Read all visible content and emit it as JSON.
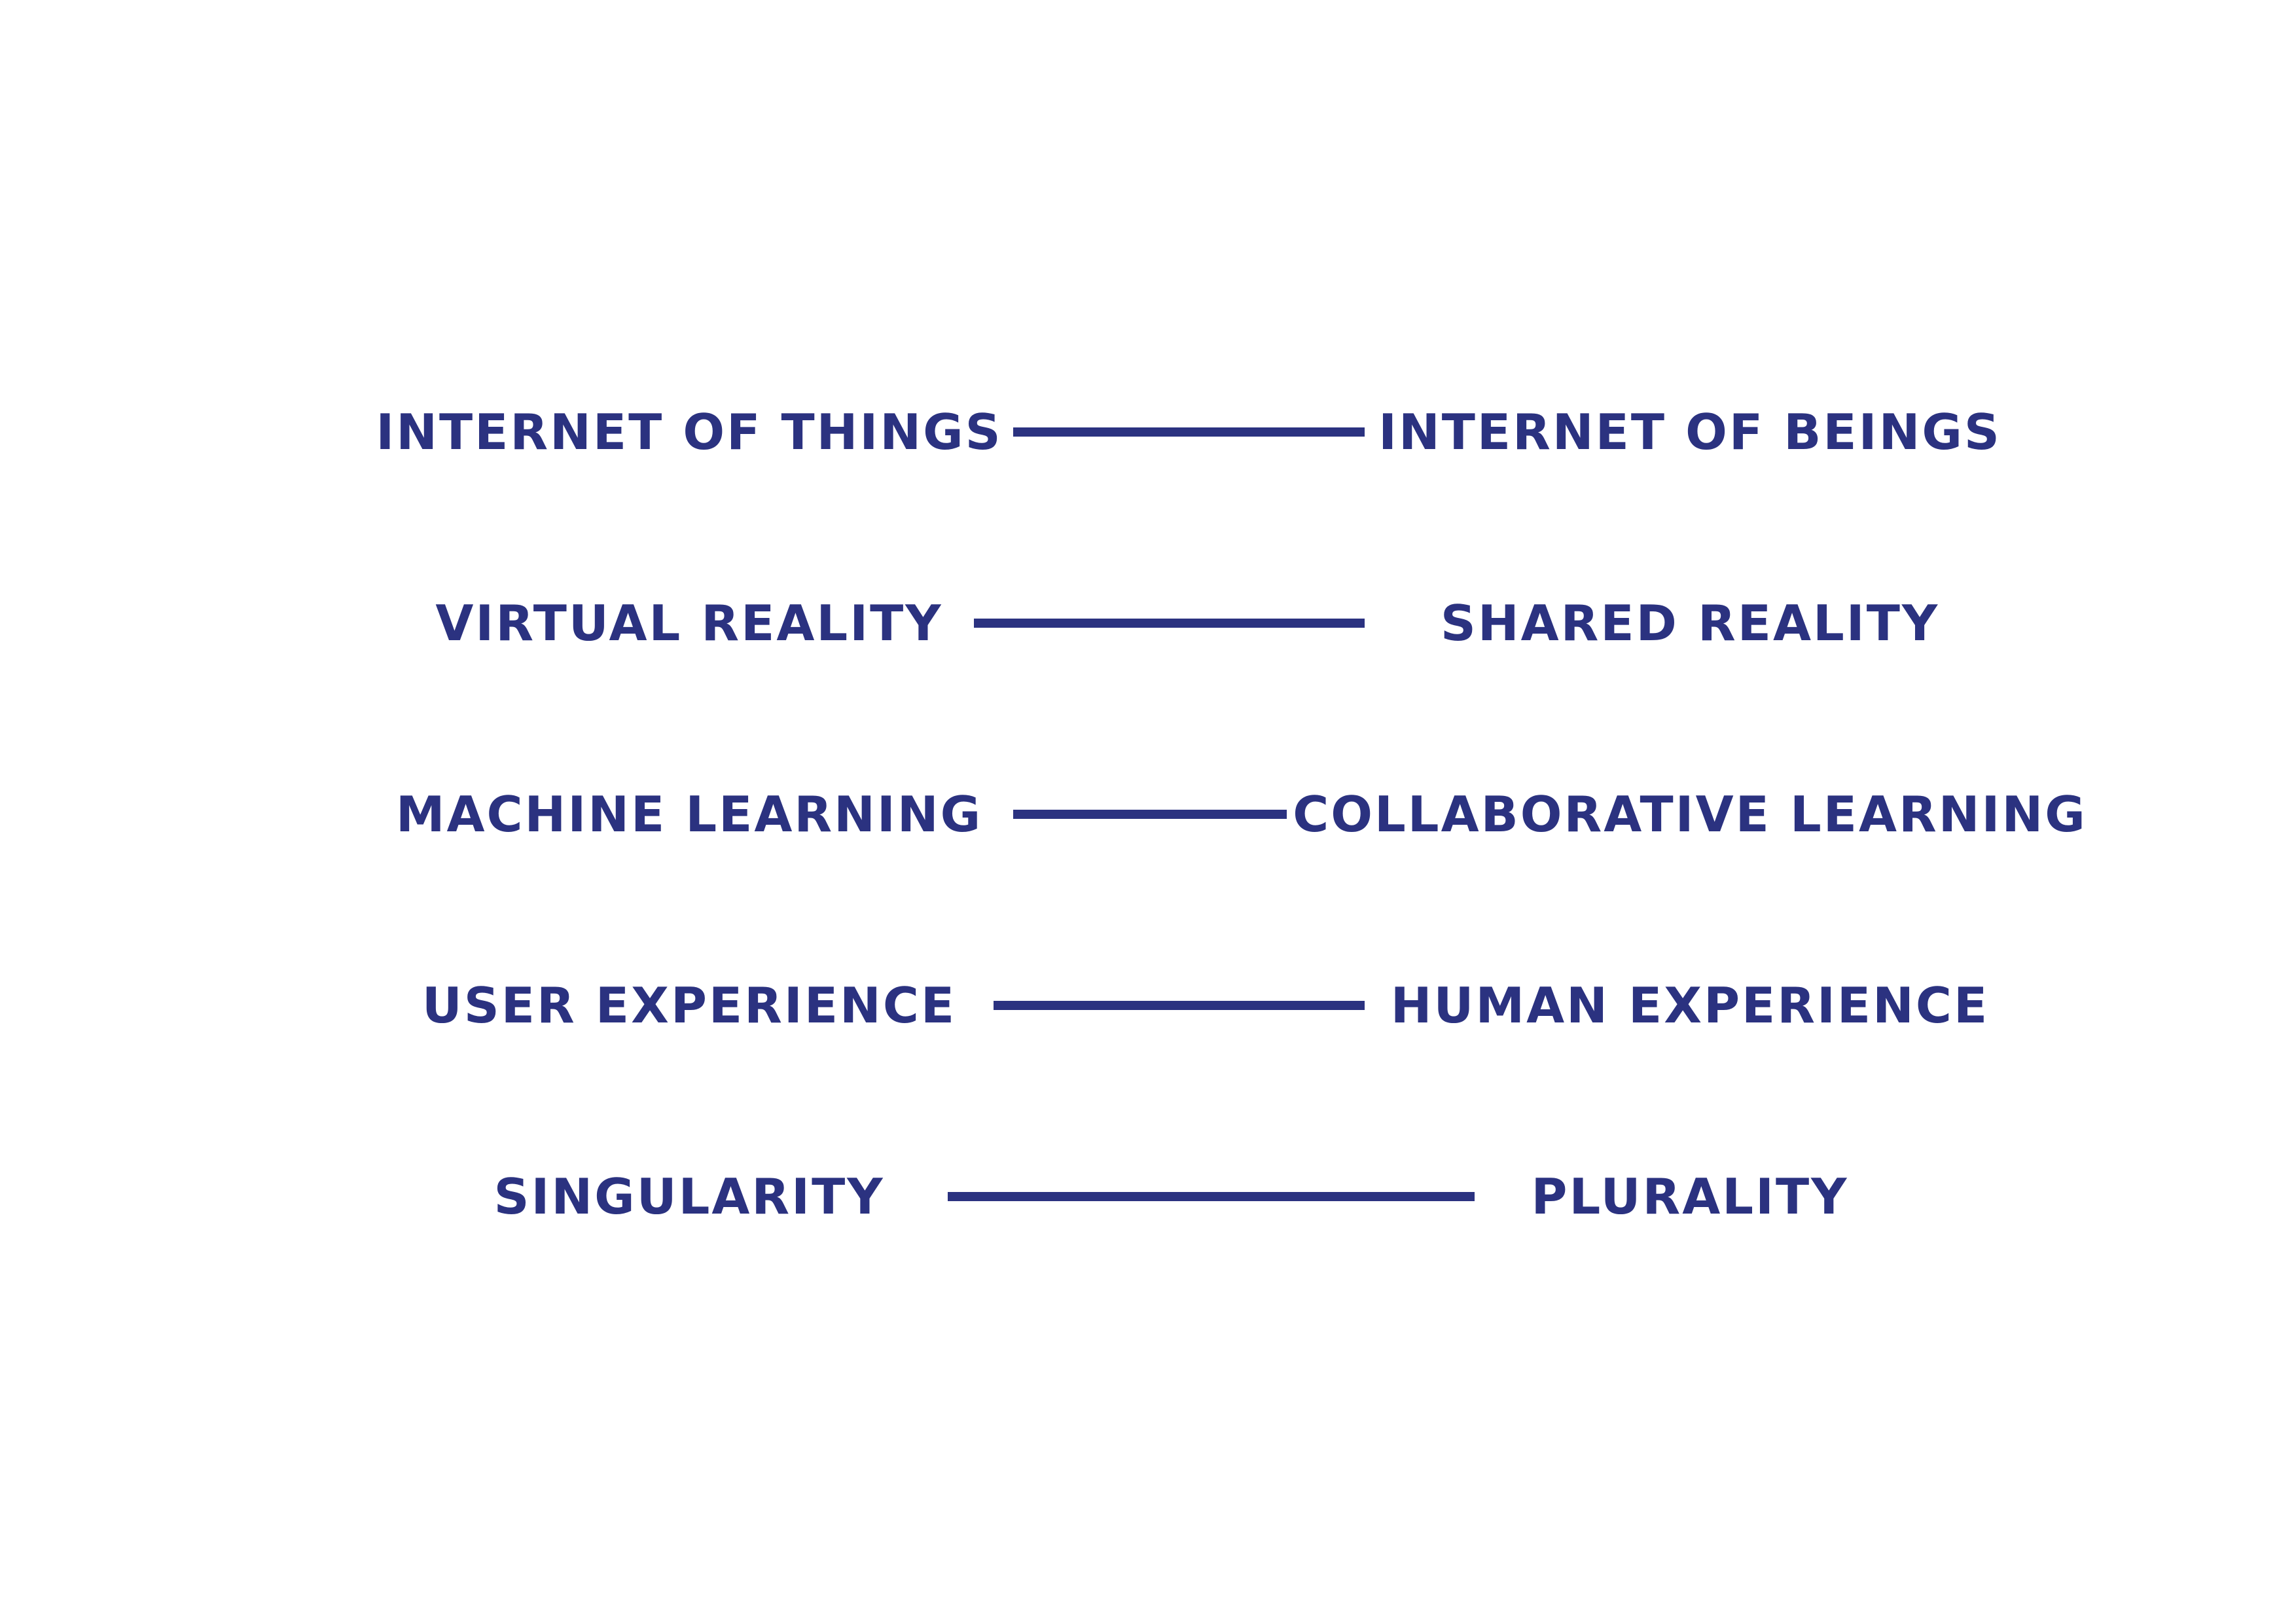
{
  "colors": {
    "ink": "#2b3280",
    "background": "#ffffff"
  },
  "pairs": [
    {
      "left": "INTERNET OF THINGS",
      "right": "INTERNET OF BEINGS"
    },
    {
      "left": "VIRTUAL REALITY",
      "right": "SHARED REALITY"
    },
    {
      "left": "MACHINE LEARNING",
      "right": "COLLABORATIVE LEARNING"
    },
    {
      "left": "USER EXPERIENCE",
      "right": "HUMAN EXPERIENCE"
    },
    {
      "left": "SINGULARITY",
      "right": "PLURALITY"
    }
  ]
}
